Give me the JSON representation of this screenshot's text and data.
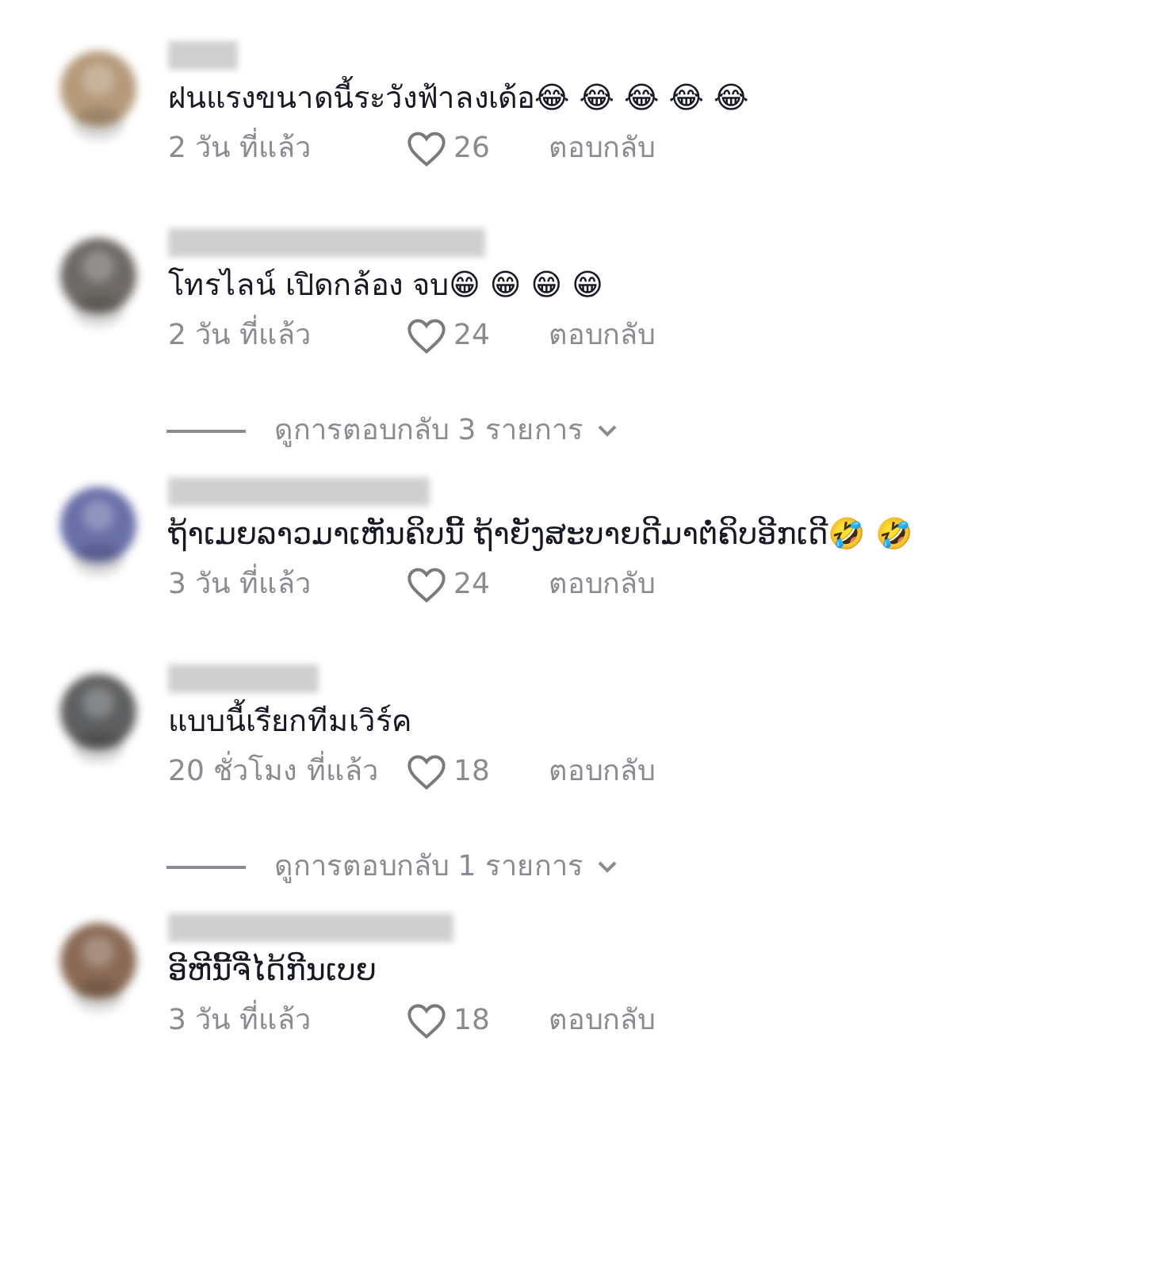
{
  "comments": [
    {
      "text": "ฝนแรงขนาดนี้ระวังฟ้าลงเด้อ😂 😂 😂 😂 😂",
      "time": "2 วัน ที่แล้ว",
      "likes": "26",
      "reply": "ตอบกลับ"
    },
    {
      "text": "โทรไลน์ เปิดกล้อง จบ😁 😁 😁 😁",
      "time": "2 วัน ที่แล้ว",
      "likes": "24",
      "reply": "ตอบกลับ",
      "view_replies": "ดูการตอบกลับ 3 รายการ"
    },
    {
      "text": "ຖ້າເມຍລາວມາເຫັນຄິບນີ້ ຖ້າຍັງສະບາຍດີມາຕໍ່ຄິບອີກເດີ🤣 🤣",
      "time": "3 วัน ที่แล้ว",
      "likes": "24",
      "reply": "ตอบกลับ"
    },
    {
      "text": "แบบนี้เรียกทีมเวิร์ค",
      "time": "20 ชั่วโมง ที่แล้ว",
      "likes": "18",
      "reply": "ตอบกลับ",
      "view_replies": "ดูการตอบกลับ 1 รายการ"
    },
    {
      "text": "ອີຫີນີ້ຈີ່ໄດ້ກີນເບຍ",
      "time": "3 วัน ที่แล้ว",
      "likes": "18",
      "reply": "ตอบกลับ"
    }
  ]
}
